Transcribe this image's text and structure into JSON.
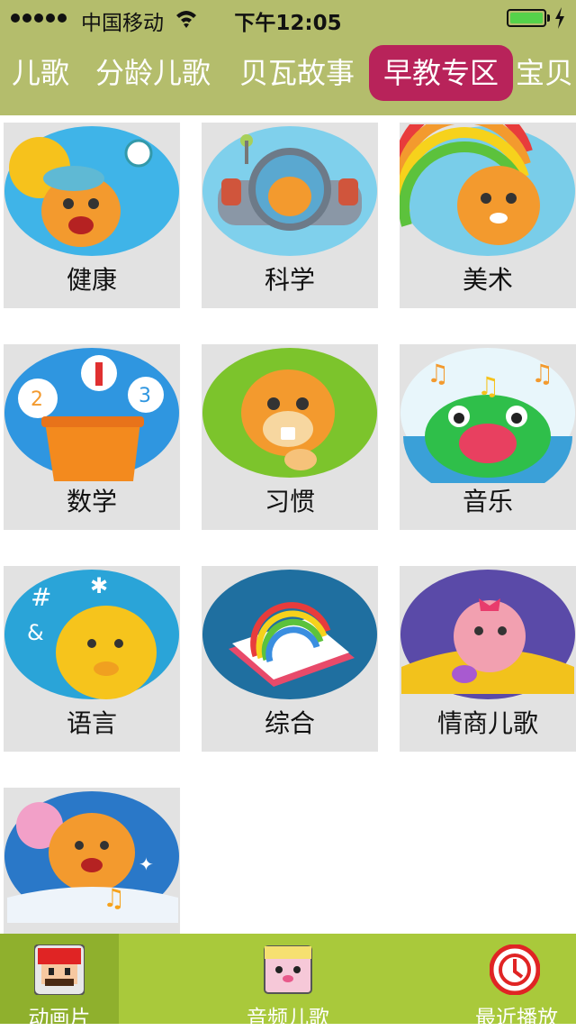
{
  "status_bar": {
    "carrier": "中国移动",
    "time": "下午12:05"
  },
  "tabs": [
    {
      "label": "儿歌",
      "active": false
    },
    {
      "label": "分龄儿歌",
      "active": false
    },
    {
      "label": "贝瓦故事",
      "active": false
    },
    {
      "label": "早教专区",
      "active": true
    },
    {
      "label": "宝贝",
      "active": false
    }
  ],
  "categories": [
    {
      "label": "健康",
      "icon": "beaver-sun-icon"
    },
    {
      "label": "科学",
      "icon": "beaver-spaceship-icon"
    },
    {
      "label": "美术",
      "icon": "beaver-rainbow-icon"
    },
    {
      "label": "数学",
      "icon": "numbers-pot-icon"
    },
    {
      "label": "习惯",
      "icon": "beaver-eating-icon"
    },
    {
      "label": "音乐",
      "icon": "music-frog-icon"
    },
    {
      "label": "语言",
      "icon": "beaver-thinking-icon"
    },
    {
      "label": "综合",
      "icon": "rainbow-book-icon"
    },
    {
      "label": "情商儿歌",
      "icon": "pink-beaver-icon"
    },
    {
      "label": "",
      "icon": "beaver-singing-icon"
    }
  ],
  "tabbar": [
    {
      "label": "动画片",
      "icon": "mario-icon",
      "selected": true
    },
    {
      "label": "音频儿歌",
      "icon": "cassette-icon",
      "selected": false
    },
    {
      "label": "最近播放",
      "icon": "recent-clock-icon",
      "selected": false
    }
  ],
  "colors": {
    "header": "#b4bd6c",
    "tab_active": "#b8235a",
    "tabbar": "#a9c93b",
    "card": "#e2e2e2"
  }
}
